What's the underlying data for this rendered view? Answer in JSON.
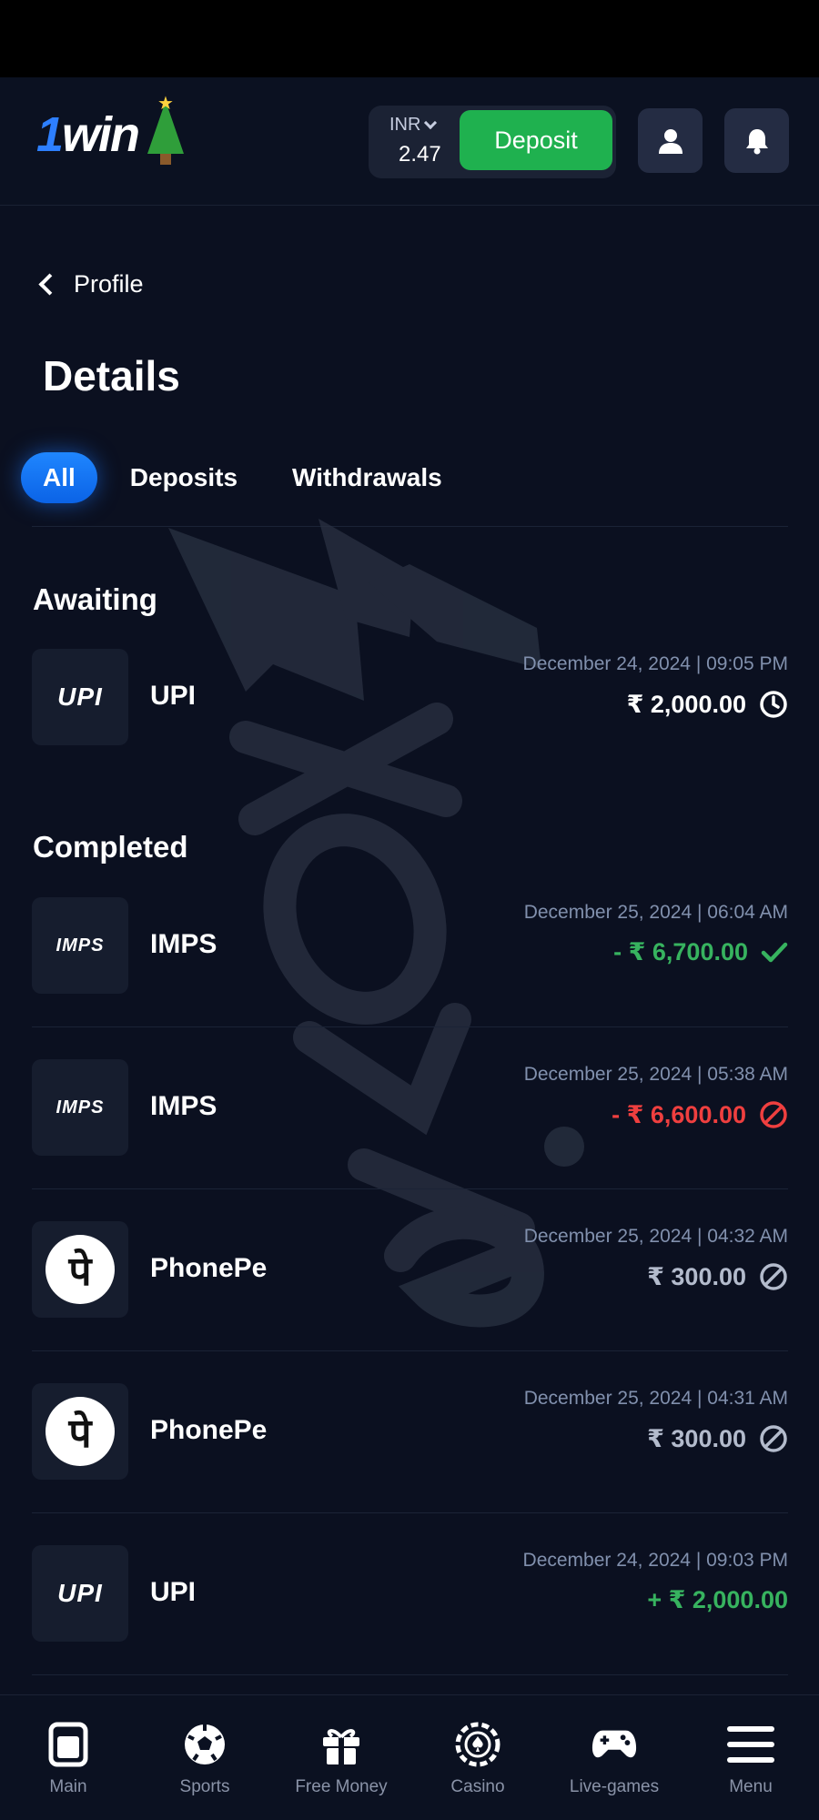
{
  "header": {
    "logo_text_one": "1",
    "logo_text_rest": "win",
    "currency": "INR",
    "balance": "2.47",
    "deposit_label": "Deposit"
  },
  "breadcrumb": {
    "back_label": "Profile"
  },
  "page_title": "Details",
  "tabs": [
    {
      "label": "All",
      "active": true
    },
    {
      "label": "Deposits",
      "active": false
    },
    {
      "label": "Withdrawals",
      "active": false
    }
  ],
  "sections": {
    "awaiting": "Awaiting",
    "completed": "Completed"
  },
  "awaiting_transactions": [
    {
      "method": "UPI",
      "logo": "UPI",
      "date": "December 24, 2024 | 09:05 PM",
      "amount": "₹ 2,000.00",
      "status": "pending",
      "status_icon": "clock-icon"
    }
  ],
  "completed_transactions": [
    {
      "method": "IMPS",
      "logo": "IMPS",
      "date": "December 25, 2024 | 06:04 AM",
      "amount": "- ₹ 6,700.00",
      "status": "success",
      "status_icon": "check-icon"
    },
    {
      "method": "IMPS",
      "logo": "IMPS",
      "date": "December 25, 2024 | 05:38 AM",
      "amount": "- ₹ 6,600.00",
      "status": "rejected",
      "status_icon": "forbidden-icon"
    },
    {
      "method": "PhonePe",
      "logo": "पे",
      "date": "December 25, 2024 | 04:32 AM",
      "amount": "₹ 300.00",
      "status": "cancelled",
      "status_icon": "forbidden-icon"
    },
    {
      "method": "PhonePe",
      "logo": "पे",
      "date": "December 25, 2024 | 04:31 AM",
      "amount": "₹ 300.00",
      "status": "cancelled",
      "status_icon": "forbidden-icon"
    },
    {
      "method": "UPI",
      "logo": "UPI",
      "date": "December 24, 2024 | 09:03 PM",
      "amount": "+ ₹ 2,000.00",
      "status": "success",
      "status_icon": ""
    }
  ],
  "bottom_nav": [
    {
      "label": "Main",
      "icon": "main-icon"
    },
    {
      "label": "Sports",
      "icon": "soccer-ball-icon"
    },
    {
      "label": "Free Money",
      "icon": "gift-icon"
    },
    {
      "label": "Casino",
      "icon": "casino-chip-icon"
    },
    {
      "label": "Live-games",
      "icon": "gamepad-icon"
    },
    {
      "label": "Menu",
      "icon": "hamburger-icon"
    }
  ],
  "colors": {
    "background": "#0b1020",
    "accent_blue": "#1f86ff",
    "deposit_green": "#1fb14f",
    "success_green": "#37b35f",
    "error_red": "#ef3f3f",
    "muted_text": "#8190ad"
  }
}
